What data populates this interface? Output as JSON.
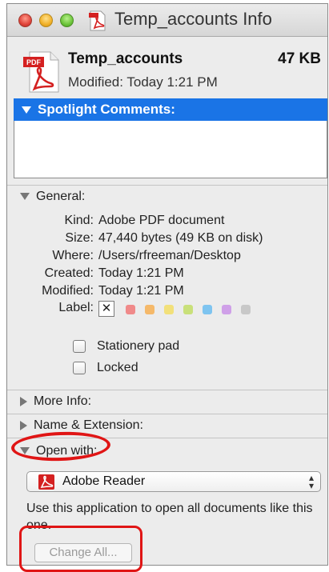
{
  "window": {
    "title": "Temp_accounts Info",
    "file_icon": "pdf-document-icon"
  },
  "file": {
    "name": "Temp_accounts",
    "size": "47 KB",
    "modified": "Modified: Today 1:21 PM",
    "icon_label": "PDF"
  },
  "spotlight": {
    "header": "Spotlight Comments:",
    "comment_value": ""
  },
  "general": {
    "header": "General:",
    "rows": [
      {
        "key": "Kind:",
        "value": "Adobe PDF document"
      },
      {
        "key": "Size:",
        "value": "47,440 bytes (49 KB on disk)"
      },
      {
        "key": "Where:",
        "value": "/Users/rfreeman/Desktop"
      },
      {
        "key": "Created:",
        "value": "Today 1:21 PM"
      },
      {
        "key": "Modified:",
        "value": "Today 1:21 PM"
      }
    ],
    "label_key": "Label:",
    "label_none": "✕",
    "label_colors": [
      "#f08a8a",
      "#f5b96a",
      "#f2e07a",
      "#c9e07a",
      "#7ec4f0",
      "#cfa0e8",
      "#c8c8c8"
    ],
    "stationery_label": "Stationery pad",
    "stationery_checked": false,
    "locked_label": "Locked",
    "locked_checked": false
  },
  "more_info": {
    "header": "More Info:"
  },
  "name_extension": {
    "header": "Name & Extension:"
  },
  "open_with": {
    "header": "Open with:",
    "app": "Adobe Reader",
    "description": "Use this application to open all documents like this one.",
    "change_all": "Change All..."
  },
  "annotations": {
    "highlight_color": "#e01515"
  }
}
